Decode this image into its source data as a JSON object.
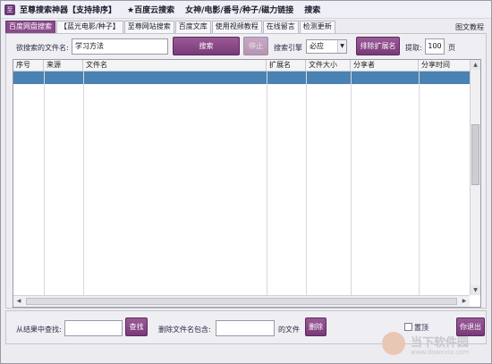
{
  "menu": {
    "app_icon": "至",
    "items": [
      "至尊搜索神器【支持排序】",
      "★百度云搜索",
      "女神/电影/番号/种子/磁力链接",
      "搜索"
    ]
  },
  "tabs": [
    {
      "label": "百度网盘搜索",
      "active": true
    },
    {
      "label": "【蓝光电影/种子】",
      "active": false
    },
    {
      "label": "至尊网站搜索",
      "active": false
    },
    {
      "label": "百度文库",
      "active": false
    },
    {
      "label": "使用视频教程",
      "active": false
    },
    {
      "label": "在线留言",
      "active": false
    },
    {
      "label": "检测更新",
      "active": false
    }
  ],
  "help_link": "图文教程",
  "search": {
    "filename_label": "欲搜索的文件名:",
    "query": "学习方法",
    "search_button": "搜索",
    "stop_button": "停止",
    "engine_label": "搜索引擎",
    "engine_value": "必应",
    "exclude_ext_button": "排除扩展名",
    "extract_label": "提取:",
    "extract_value": "100",
    "page_unit": "页"
  },
  "table": {
    "columns": [
      "序号",
      "来源",
      "文件名",
      "扩展名",
      "文件大小",
      "分享者",
      "分享时间"
    ]
  },
  "bottom": {
    "find_in_results_label": "从结果中查找:",
    "find_button": "查找",
    "delete_filter_label": "删除文件名包含:",
    "files_suffix": "的文件",
    "delete_button": "删除",
    "pin_label": "置顶",
    "exit_button": "你退出"
  },
  "watermark": {
    "text": "当下软件园",
    "url": "www.downxia.com"
  },
  "colors": {
    "accent": "#8a4a8a",
    "selection": "#4a82b4"
  }
}
